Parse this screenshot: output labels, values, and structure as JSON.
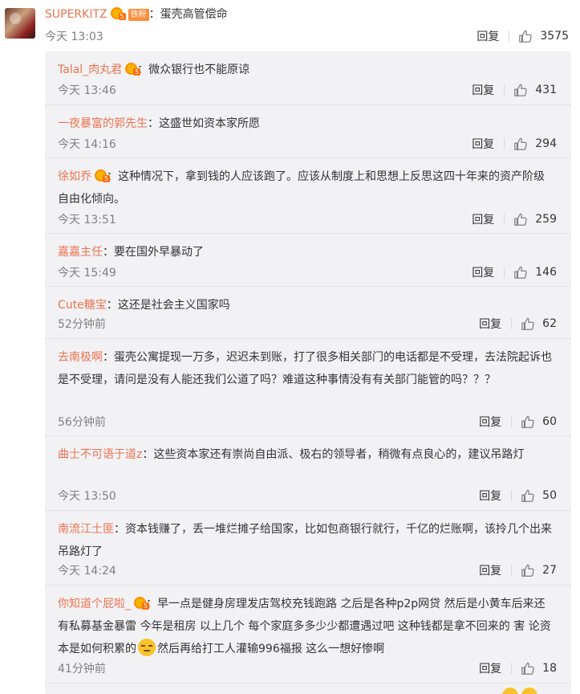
{
  "top_comment": {
    "username": "SUPERKITZ",
    "fan_badge": "铁粉",
    "colon": "：",
    "text": "蛋壳高管偿命",
    "time": "今天 13:03",
    "reply_label": "回复",
    "likes": "3575"
  },
  "replies": [
    {
      "username": "Talal_肉丸君",
      "vip": true,
      "text": "微众银行也不能原谅",
      "time": "今天 13:46",
      "reply_label": "回复",
      "likes": "431"
    },
    {
      "username": "一夜暴富的郭先生",
      "vip": false,
      "text": "这盛世如资本家所愿",
      "time": "今天 14:16",
      "reply_label": "回复",
      "likes": "294"
    },
    {
      "username": "徐如乔",
      "vip": true,
      "text": "这种情况下，拿到钱的人应该跑了。应该从制度上和思想上反思这四十年来的资产阶级自由化倾向。",
      "time": "今天 13:51",
      "reply_label": "回复",
      "likes": "259"
    },
    {
      "username": "嘉嘉主任",
      "vip": false,
      "text": "要在国外早暴动了",
      "time": "今天 15:49",
      "reply_label": "回复",
      "likes": "146"
    },
    {
      "username": "Cute糖宝",
      "vip": false,
      "text": "这还是社会主义国家吗",
      "time": "52分钟前",
      "reply_label": "回复",
      "likes": "62"
    },
    {
      "username": "去南极啊",
      "vip": false,
      "text": "蛋壳公寓提现一万多，迟迟未到账，打了很多相关部门的电话都是不受理，去法院起诉也是不受理，请问是没有人能还我们公道了吗？难道这种事情没有有关部门能管的吗？？？",
      "time": "56分钟前",
      "reply_label": "回复",
      "likes": "60"
    },
    {
      "username": "曲士不可语于道z",
      "vip": false,
      "text": "这些资本家还有崇尚自由派、极右的领导者，稍微有点良心的，建议吊路灯",
      "time": "今天 13:50",
      "reply_label": "回复",
      "likes": "50"
    },
    {
      "username": "南流江土匪",
      "vip": false,
      "text": "资本钱赚了，丢一堆烂摊子给国家，比如包商银行就行，千亿的烂账啊，该拎几个出来吊路灯了",
      "time": "今天 14:24",
      "reply_label": "回复",
      "likes": "27"
    },
    {
      "username": "你知道个屁啦_",
      "vip": true,
      "text_before_emoji": "早一点是健身房理发店驾校充钱跑路 之后是各种p2p网贷 然后是小黄车后来还有私募基金暴雷 今年是租房 以上几个 每个家庭多多少少都遭遇过吧 这种钱都是拿不回来的 害 论资本是如何积累的",
      "emoji": "sweat-face",
      "text_after_emoji": "然后再给打工人灌输996福报 这么一想好惨啊",
      "time": "41分钟前",
      "reply_label": "回复",
      "likes": "18"
    }
  ],
  "colon": "：",
  "icons": {
    "like": "thumbs-up-icon",
    "vip": "vip-level-badge-icon",
    "avatar": "user-avatar"
  },
  "colors": {
    "username": "#eb7350",
    "text": "#333333",
    "muted": "#808080",
    "replies_bg": "#f2f2f5",
    "fan_badge": "#ff8c3a"
  }
}
